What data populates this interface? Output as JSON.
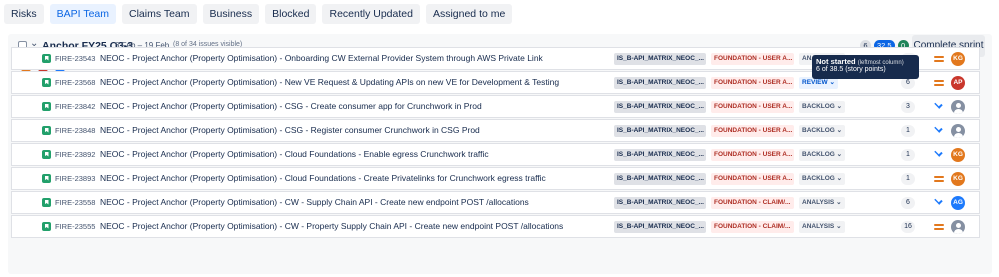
{
  "filters": [
    "Risks",
    "BAPI Team",
    "Claims Team",
    "Business",
    "Blocked",
    "Recently Updated",
    "Assigned to me"
  ],
  "active_filter": "BAPI Team",
  "sprint": {
    "name": "Anchor FY25 Q3-3",
    "dates": "6 Feb – 19 Feb",
    "issue_count": "(8 of 34 issues visible)",
    "points": {
      "not_started": "6",
      "in_progress": "32.5",
      "done": "0"
    },
    "complete_button": "Complete sprint",
    "avatars": [
      "KG",
      "AP",
      "AG"
    ],
    "more": "•••"
  },
  "tooltip": {
    "title": "Not started",
    "hint": "(leftmost column)",
    "body": "6 of 38.5 (story points)"
  },
  "issues": [
    {
      "key": "FIRE-23543",
      "summary": "NEOC - Project Anchor (Property Optimisation) - Onboarding CW External Provider System through AWS Private Link",
      "label": "IS_B-API_MATRIX_NEOC_...",
      "epic": "FOUNDATION - USER A...",
      "status": "ANALYSIS",
      "points": "4.5",
      "priority": "medium",
      "assignee": "KG"
    },
    {
      "key": "FIRE-23568",
      "summary": "NEOC - Project Anchor (Property Optimisation) - New VE Request & Updating APIs on new VE for Development & Testing",
      "label": "IS_B-API_MATRIX_NEOC_...",
      "epic": "FOUNDATION - USER A...",
      "status": "REVIEW",
      "points": "6",
      "priority": "medium",
      "assignee": "AP"
    },
    {
      "key": "FIRE-23842",
      "summary": "NEOC - Project Anchor (Property Optimisation) - CSG - Create consumer app for Crunchwork in Prod",
      "label": "IS_B-API_MATRIX_NEOC_...",
      "epic": "FOUNDATION - USER A...",
      "status": "BACKLOG",
      "points": "3",
      "priority": "low",
      "assignee": ""
    },
    {
      "key": "FIRE-23848",
      "summary": "NEOC - Project Anchor (Property Optimisation) - CSG - Register consumer Crunchwork in CSG Prod",
      "label": "IS_B-API_MATRIX_NEOC_...",
      "epic": "FOUNDATION - USER A...",
      "status": "BACKLOG",
      "points": "1",
      "priority": "low",
      "assignee": ""
    },
    {
      "key": "FIRE-23892",
      "summary": "NEOC - Project Anchor (Property Optimisation) - Cloud Foundations - Enable egress Crunchwork traffic",
      "label": "IS_B-API_MATRIX_NEOC_...",
      "epic": "FOUNDATION - USER A...",
      "status": "BACKLOG",
      "points": "1",
      "priority": "low",
      "assignee": "KG"
    },
    {
      "key": "FIRE-23893",
      "summary": "NEOC - Project Anchor (Property Optimisation) - Cloud Foundations - Create Privatelinks for Crunchwork egress traffic",
      "label": "IS_B-API_MATRIX_NEOC_...",
      "epic": "FOUNDATION - USER A...",
      "status": "BACKLOG",
      "points": "1",
      "priority": "medium",
      "assignee": "KG"
    },
    {
      "key": "FIRE-23558",
      "summary": "NEOC - Project Anchor (Property Optimisation) - CW - Supply Chain API - Create new endpoint POST /allocations",
      "label": "IS_B-API_MATRIX_NEOC_...",
      "epic": "FOUNDATION - CLAIM/...",
      "status": "ANALYSIS",
      "points": "6",
      "priority": "low",
      "assignee": "AG"
    },
    {
      "key": "FIRE-23555",
      "summary": "NEOC - Project Anchor (Property Optimisation) - CW - Property Supply Chain API - Create new endpoint POST /allocations",
      "label": "IS_B-API_MATRIX_NEOC_...",
      "epic": "FOUNDATION - CLAIM/...",
      "status": "ANALYSIS",
      "points": "16",
      "priority": "medium",
      "assignee": ""
    }
  ]
}
